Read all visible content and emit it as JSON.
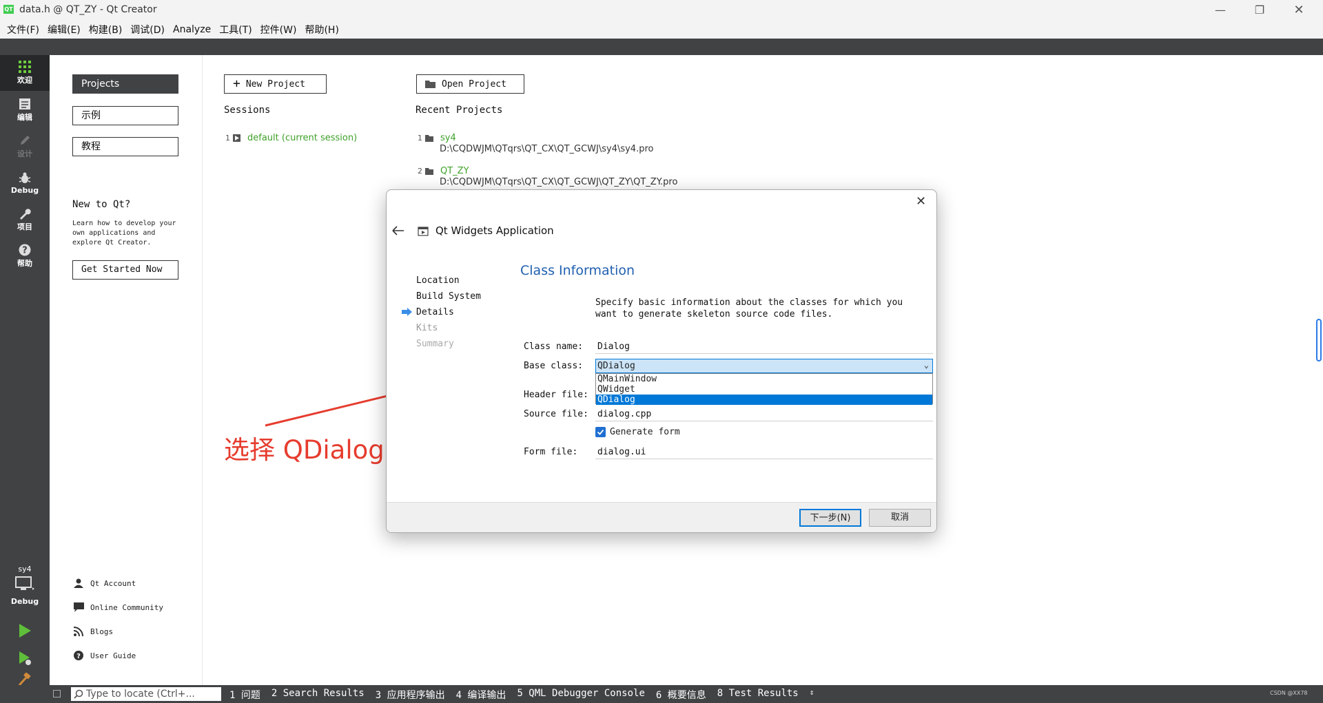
{
  "window": {
    "title": "data.h @ QT_ZY - Qt Creator",
    "app_icon": "QT",
    "controls": [
      "minimize-icon",
      "restore-icon",
      "close-icon"
    ]
  },
  "menu": [
    "文件(F)",
    "编辑(E)",
    "构建(B)",
    "调试(D)",
    "Analyze",
    "工具(T)",
    "控件(W)",
    "帮助(H)"
  ],
  "modes": [
    {
      "label": "欢迎",
      "icon": "grid-icon",
      "active": true
    },
    {
      "label": "编辑",
      "icon": "document-icon"
    },
    {
      "label": "设计",
      "icon": "pencil-icon",
      "disabled": true
    },
    {
      "label": "Debug",
      "icon": "bug-icon"
    },
    {
      "label": "项目",
      "icon": "wrench-icon"
    },
    {
      "label": "帮助",
      "icon": "help-icon"
    }
  ],
  "kit": {
    "project": "sy4",
    "config": "Debug"
  },
  "welcome": {
    "projects_btn": "Projects",
    "examples_btn": "示例",
    "tutorials_btn": "教程",
    "new_heading": "New to Qt?",
    "new_desc": "Learn how to develop your own applications and explore Qt Creator.",
    "get_started": "Get Started Now",
    "links": [
      "Qt Account",
      "Online Community",
      "Blogs",
      "User Guide"
    ]
  },
  "main": {
    "new_project": "New Project",
    "open_project": "Open Project",
    "sessions_heading": "Sessions",
    "recent_heading": "Recent Projects",
    "sessions": [
      {
        "num": "1",
        "name": "default (current session)"
      }
    ],
    "recent": [
      {
        "num": "1",
        "name": "sy4",
        "path": "D:\\CQDWJM\\QTqrs\\QT_CX\\QT_GCWJ\\sy4\\sy4.pro"
      },
      {
        "num": "2",
        "name": "QT_ZY",
        "path": "D:\\CQDWJM\\QTqrs\\QT_CX\\QT_GCWJ\\QT_ZY\\QT_ZY.pro"
      }
    ]
  },
  "dialog": {
    "wizard_title": "Qt Widgets Application",
    "page_title": "Class Information",
    "steps": [
      "Location",
      "Build System",
      "Details",
      "Kits",
      "Summary"
    ],
    "description": "Specify basic information about the classes for which you want to generate skeleton source code files.",
    "class_name_label": "Class name:",
    "class_name": "Dialog",
    "base_class_label": "Base class:",
    "base_class": "QDialog",
    "base_options": [
      "QMainWindow",
      "QWidget",
      "QDialog"
    ],
    "header_file_label": "Header file:",
    "source_file_label": "Source file:",
    "source_file": "dialog.cpp",
    "generate_form": "Generate form",
    "form_file_label": "Form file:",
    "form_file": "dialog.ui",
    "next_btn": "下一步(N)",
    "cancel_btn": "取消"
  },
  "annotation": "选择 QDialog",
  "status": {
    "locator_placeholder": "Type to locate (Ctrl+...",
    "tabs": [
      "1 问题",
      "2 Search Results",
      "3 应用程序输出",
      "4 编译输出",
      "5 QML Debugger Console",
      "6 概要信息",
      "8 Test Results"
    ],
    "watermark": "CSDN @XX78"
  },
  "colors": {
    "accent": "#0078d7",
    "project_link": "#3ea128",
    "annotation": "#e63c2e",
    "dark": "#404244"
  }
}
